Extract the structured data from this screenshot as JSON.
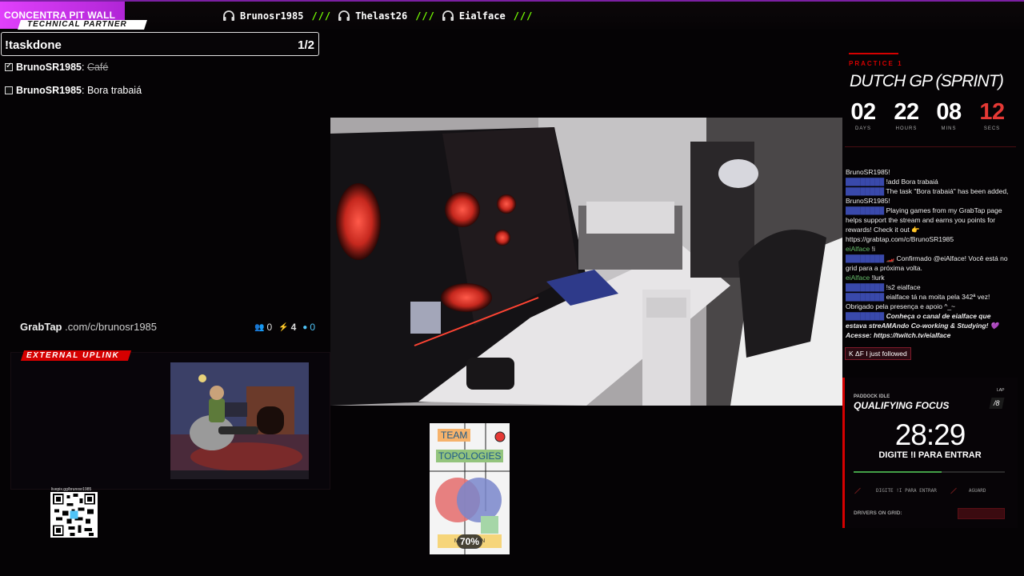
{
  "topbar": {
    "brand": "CONCENTRA PIT WALL",
    "ticker": [
      {
        "name": "Brunosr1985",
        "icon": "headphones-icon"
      },
      {
        "name": "Thelast26",
        "icon": "headphones-icon"
      },
      {
        "name": "Eialface",
        "icon": "headphones-icon"
      }
    ],
    "separator": "///"
  },
  "task_panel": {
    "badge": "TECHNICAL PARTNER",
    "title": "!taskdone",
    "count": "1/2",
    "tasks": [
      {
        "user": "BrunoSR1985",
        "text": "Café",
        "done": true
      },
      {
        "user": "BrunoSR1985",
        "text": "Bora trabaiá",
        "done": false
      }
    ],
    "grabtap": {
      "logo": "GrabTap",
      "url": ".com/c/brunosr1985",
      "stats": [
        {
          "icon": "people-icon",
          "value": "0"
        },
        {
          "icon": "bolt-icon",
          "value": "4"
        },
        {
          "icon": "points-icon",
          "value": "0"
        }
      ]
    }
  },
  "uplink": {
    "badge": "EXTERNAL UPLINK"
  },
  "qr": {
    "label": "livepix.gg/brunosr1985"
  },
  "book": {
    "title_line1": "TEAM",
    "title_line2": "TOPOLOGIES",
    "author": "MATT        LTON",
    "progress": "70%"
  },
  "race": {
    "session": "PRACTICE 1",
    "title": "DUTCH GP (SPRINT)",
    "countdown": [
      {
        "value": "02",
        "label": "DAYS"
      },
      {
        "value": "22",
        "label": "HOURS"
      },
      {
        "value": "08",
        "label": "MINS"
      },
      {
        "value": "12",
        "label": "SECS"
      }
    ],
    "accent": "#d50000"
  },
  "chat": {
    "lines": [
      {
        "user": "",
        "text": "BrunoSR1985!"
      },
      {
        "user": "",
        "text": "!add Bora trabaiá"
      },
      {
        "user": "",
        "text": "The task \"Bora trabaiá\" has been added, BrunoSR1985!"
      },
      {
        "user": "",
        "text": "Playing games from my GrabTap page helps support the stream and earns you points for rewards! Check it out 👉 https://grabtap.com/c/BrunoSR1985"
      },
      {
        "user": "eiAlface",
        "text": "!i"
      },
      {
        "user": "",
        "text": "🏎️ Confirmado @eiAlface! Você está no grid para a próxima volta."
      },
      {
        "user": "eiAlface",
        "text": "!lurk"
      },
      {
        "user": "",
        "text": "!s2 eialface"
      },
      {
        "user": "",
        "text": "eialface tá na moita pela 342ª vez! Obrigado pela presença e apoio ^_~"
      },
      {
        "user": "",
        "text": "Conheça o canal de eialface que estava streAMAndo Co-working & Studying! 💜 Acesse: https://twitch.tv/eialface",
        "italic": true
      }
    ],
    "follow_alert": "K ΔF I just followed"
  },
  "qualifying": {
    "status": "PADDOCK IDLE",
    "title": "QUALIFYING FOCUS",
    "lap_label": "LAP",
    "lap_value": "/8",
    "timer": "28:29",
    "subtitle": "DIGITE !I PARA ENTRAR",
    "progress": 0.58,
    "row_left": "DIGITE !I PARA ENTRAR",
    "row_right": "AGUARD",
    "drivers_label": "DRIVERS ON GRID:"
  }
}
